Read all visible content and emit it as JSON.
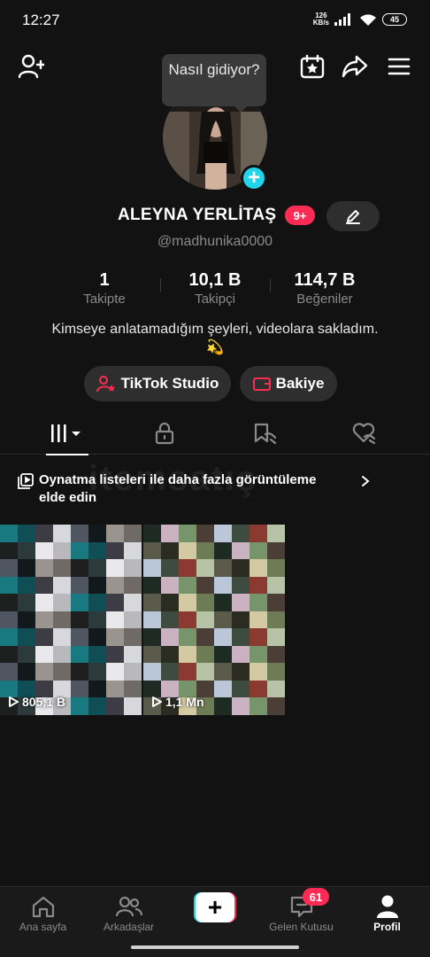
{
  "status_bar": {
    "time": "12:27",
    "speed_value": "126",
    "speed_unit": "KB/s",
    "battery": "45"
  },
  "tooltip": {
    "text": "Nasıl gidiyor?"
  },
  "profile": {
    "name": "ALEYNA YERLİTAŞ",
    "notification_badge": "9+",
    "handle": "@madhunika0000",
    "bio_line1": "Kimseye anlatamadığım şeyleri, videolara sakladım.",
    "bio_line2": "💫"
  },
  "stats": [
    {
      "value": "1",
      "label": "Takipte"
    },
    {
      "value": "10,1 B",
      "label": "Takipçi"
    },
    {
      "value": "114,7 B",
      "label": "Beğeniler"
    }
  ],
  "actions": {
    "studio_label": "TikTok Studio",
    "balance_label": "Bakiye"
  },
  "tabs": [
    {
      "name": "videos",
      "active": true
    },
    {
      "name": "private",
      "active": false
    },
    {
      "name": "reposts",
      "active": false
    },
    {
      "name": "liked",
      "active": false
    }
  ],
  "banner": {
    "text": "Oynatma listeleri ile daha fazla görüntüleme elde edin"
  },
  "watermark": "itemsatış",
  "videos": [
    {
      "views": "805,1 B"
    },
    {
      "views": "1,1 Mn"
    }
  ],
  "bottom_nav": {
    "home": "Ana sayfa",
    "friends": "Arkadaşlar",
    "inbox": "Gelen Kutusu",
    "inbox_badge": "61",
    "profile": "Profil"
  },
  "colors": {
    "accent_pink": "#fe2c55",
    "accent_cyan": "#20d5ec",
    "background": "#121212"
  }
}
